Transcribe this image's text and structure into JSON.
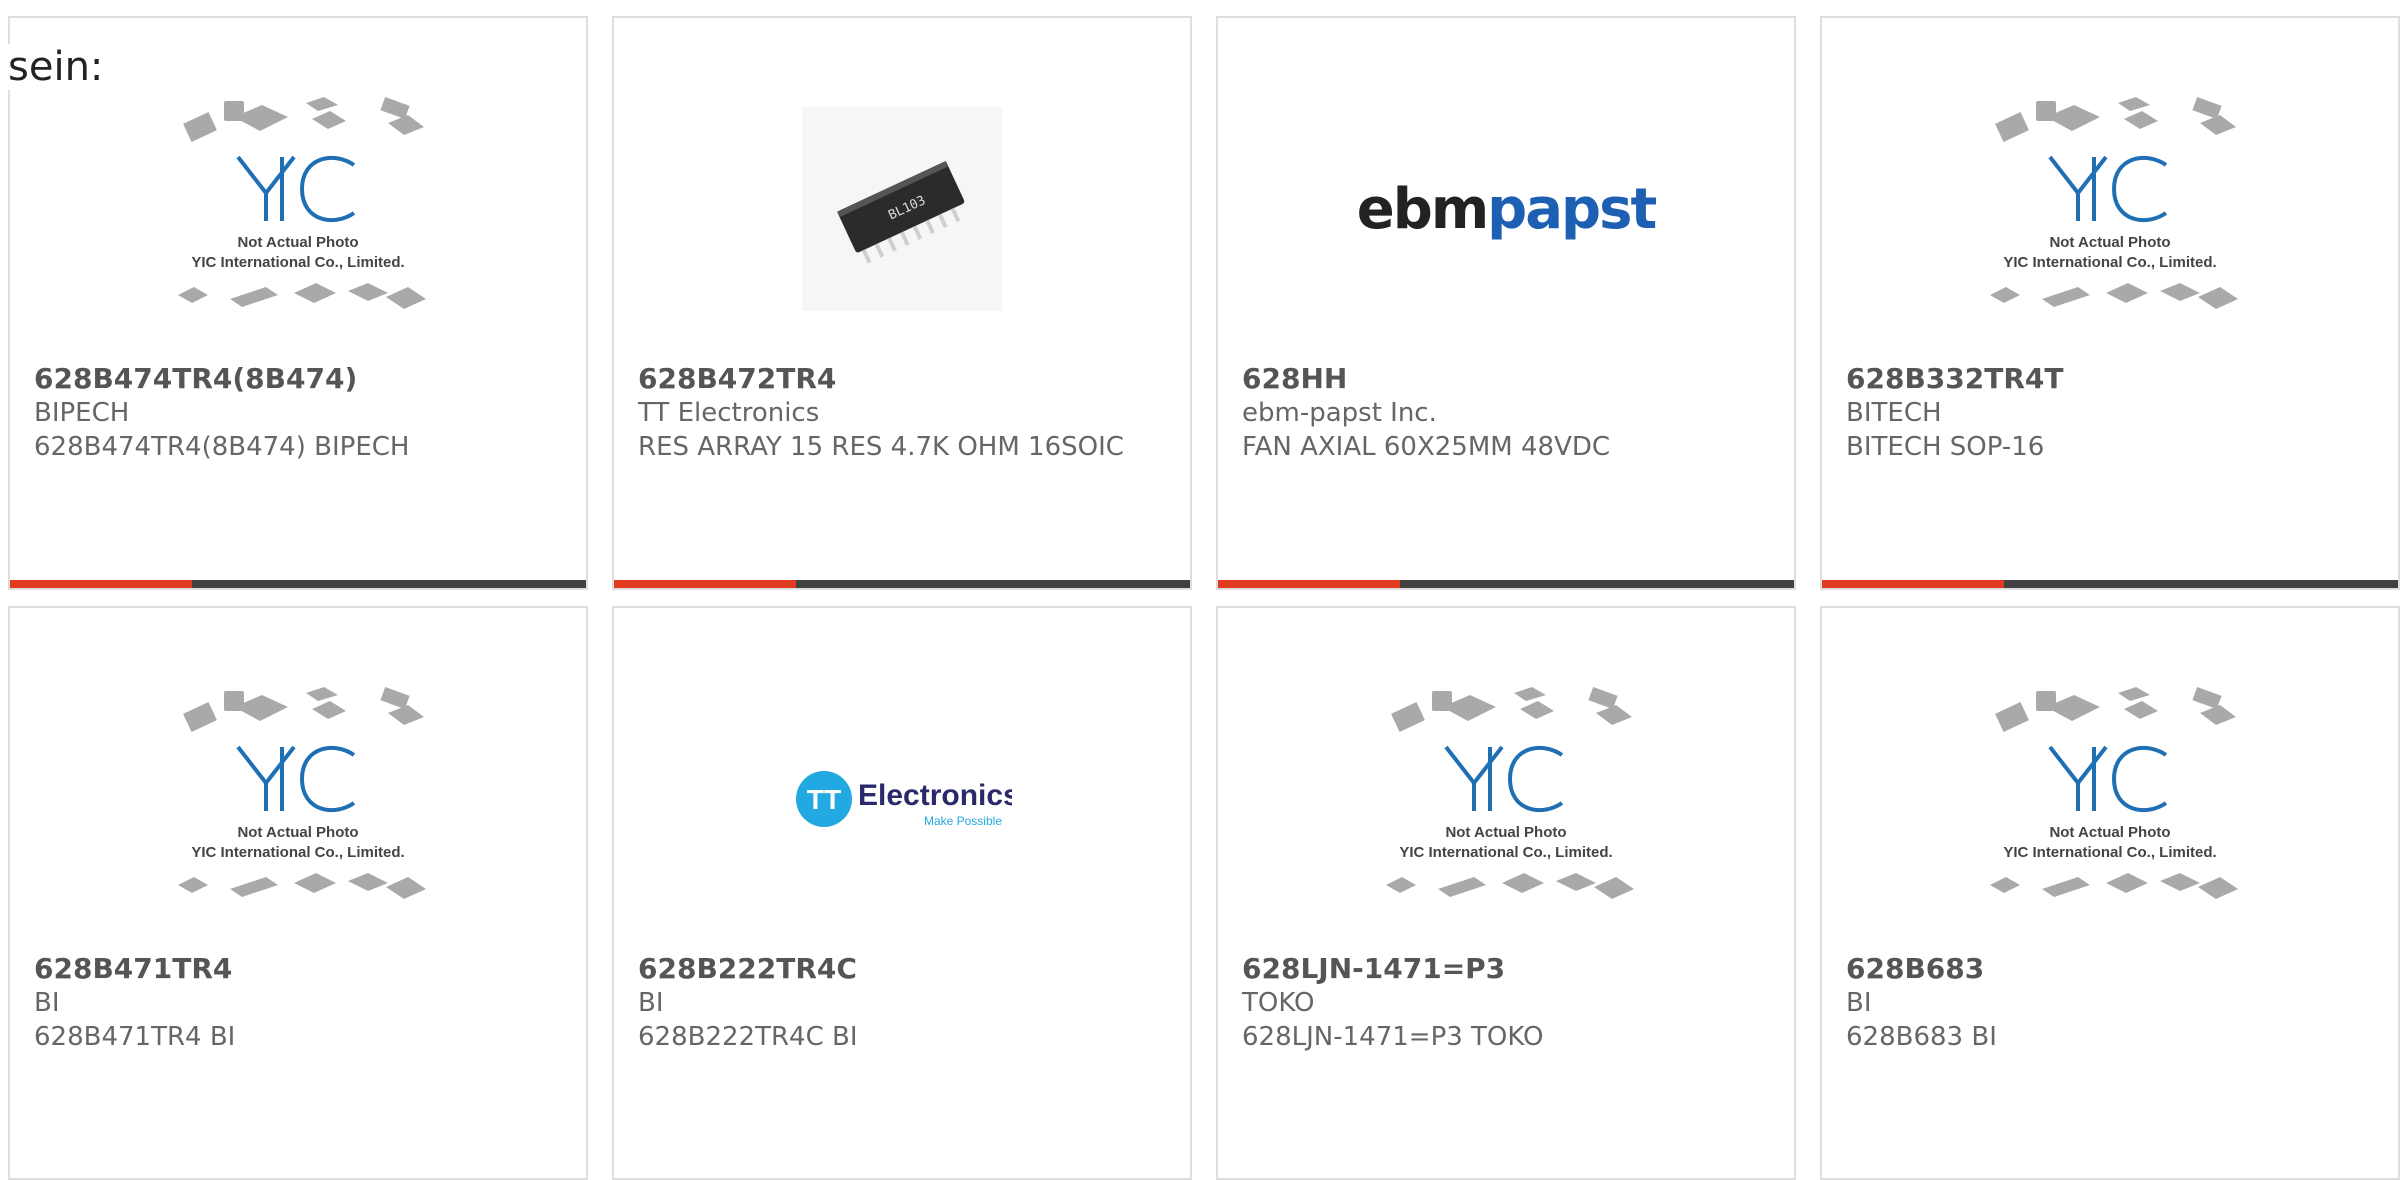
{
  "intro_text": "sein:",
  "placeholder": {
    "line1": "Not Actual Photo",
    "line2": "YIC International Co., Limited.",
    "logo": "YIC"
  },
  "products": [
    {
      "part": "628B474TR4(8B474)",
      "manufacturer": "BIPECH",
      "description": "628B474TR4(8B474) BIPECH",
      "image": "placeholder"
    },
    {
      "part": "628B472TR4",
      "manufacturer": "TT Electronics",
      "description": "RES ARRAY 15 RES 4.7K OHM 16SOIC",
      "image": "chip-photo",
      "chip_marking": "BL103"
    },
    {
      "part": "628HH",
      "manufacturer": "ebm-papst Inc.",
      "description": "FAN AXIAL 60X25MM 48VDC",
      "image": "ebmpapst-logo",
      "logo_left": "ebm",
      "logo_right": "papst"
    },
    {
      "part": "628B332TR4T",
      "manufacturer": "BITECH",
      "description": "BITECH SOP-16",
      "image": "placeholder"
    },
    {
      "part": "628B471TR4",
      "manufacturer": "BI",
      "description": "628B471TR4 BI",
      "image": "placeholder"
    },
    {
      "part": "628B222TR4C",
      "manufacturer": "BI",
      "description": "628B222TR4C BI",
      "image": "tt-electronics-logo",
      "logo_badge": "TT",
      "logo_word": "Electronics",
      "logo_tagline": "Make Possible"
    },
    {
      "part": "628LJN-1471=P3",
      "manufacturer": "TOKO",
      "description": "628LJN-1471=P3 TOKO",
      "image": "placeholder"
    },
    {
      "part": "628B683",
      "manufacturer": "BI",
      "description": "628B683 BI",
      "image": "placeholder"
    }
  ],
  "colors": {
    "accent": "#e33b1f",
    "bar": "#404040",
    "yic_blue": "#1f6fb5",
    "tt_blue": "#23a9e1",
    "papst_blue": "#1d5fb2"
  }
}
